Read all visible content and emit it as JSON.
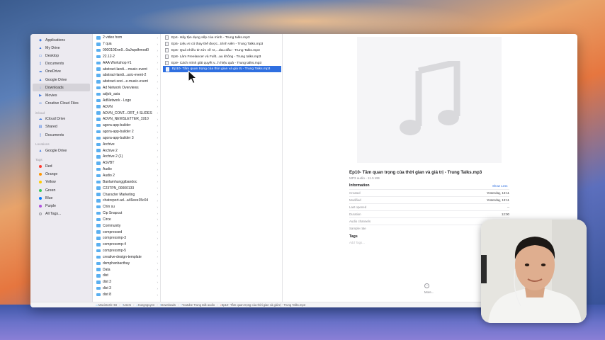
{
  "sidebar": {
    "favorites": [
      {
        "label": "Applications",
        "icon": "applications-icon"
      },
      {
        "label": "My Drive",
        "icon": "drive-icon"
      },
      {
        "label": "Desktop",
        "icon": "desktop-icon"
      },
      {
        "label": "Documents",
        "icon": "document-icon"
      },
      {
        "label": "OneDrive",
        "icon": "cloud-icon"
      },
      {
        "label": "Google Drive",
        "icon": "drive-icon"
      },
      {
        "label": "Downloads",
        "icon": "download-icon",
        "selected": true
      },
      {
        "label": "Movies",
        "icon": "movies-icon"
      },
      {
        "label": "Creative Cloud Files",
        "icon": "creative-cloud-icon"
      }
    ],
    "icloud_header": "iCloud",
    "icloud": [
      {
        "label": "iCloud Drive",
        "icon": "icloud-drive-icon"
      },
      {
        "label": "Shared",
        "icon": "shared-folder-icon"
      },
      {
        "label": "Documents",
        "icon": "document-icon"
      }
    ],
    "locations_header": "Locations",
    "locations": [
      {
        "label": "Google Drive",
        "icon": "drive-icon"
      }
    ],
    "tags_header": "Tags",
    "tags": [
      {
        "label": "Red",
        "color": "#ff3b30"
      },
      {
        "label": "Orange",
        "color": "#ff9500"
      },
      {
        "label": "Yellow",
        "color": "#ffcc00"
      },
      {
        "label": "Green",
        "color": "#34c759"
      },
      {
        "label": "Blue",
        "color": "#007aff"
      },
      {
        "label": "Purple",
        "color": "#af52de"
      },
      {
        "label": "All Tags...",
        "color": ""
      }
    ]
  },
  "folders": [
    "2 video hom",
    "7 qua",
    "000010Enn9...0aJwpdhmod0",
    "22.12-2",
    "AAA Workshop #1",
    "abstract-landi...-music-event",
    "abstract-landi...usic-event-2",
    "abstract-soci...e-music-event",
    "Ad Network Overviews",
    "adjob_asia",
    "AdNetwork - Logo",
    "ADVN",
    "ADVN_CONT...ORT_4 SLIDES",
    "ADVN_NEWSLETTER_1910",
    "agora-app-builder",
    "agora-app-builder 2",
    "agora-app-builder 3",
    "Archive",
    "Archive 2",
    "Archive 2 (1)",
    "ASVBT",
    "Audio",
    "Audio 2",
    "Banlamhunggibandoc",
    "C23TPN_00000133",
    "Character Marketing",
    "chatreport-ad...a46eee35c04",
    "Chin su",
    "Cip Snapcut",
    "Circe",
    "Community",
    "compressed",
    "compressmp-3",
    "compressmp-4",
    "compressmp-5",
    "creative-design-template",
    "dsmphanbacthay",
    "Data",
    "dist",
    "dist 3",
    "dist 3",
    "dist 8"
  ],
  "files": [
    {
      "name": "Ep4- Hãy tận dụng sếp của mình - Trung talks.mp3"
    },
    {
      "name": "Ep5- Liệu AI có thay thế được...trình viên - Trung Talks.mp3"
    },
    {
      "name": "Ep6- Quá nhiều tin tức về AI,...đau đầu - Trung Talks.mp3"
    },
    {
      "name": "Ep8- Làm Freelancer và Fullt...au không - Trung talks.mp3"
    },
    {
      "name": "Ep9- Cách mình giải quyết v...h hiệu quả - Trung talks.mp3"
    },
    {
      "name": "Ep10- Tầm quan trọng của thời gian và giá trị - Trung Talks.mp3",
      "selected": true
    }
  ],
  "preview": {
    "title": "Ep10- Tầm quan trọng của thời gian và giá trị - Trung Talks.mp3",
    "subtitle": "MP3 audio - 11.5 MB",
    "info_header": "Information",
    "show_less": "Show Less",
    "rows": [
      {
        "label": "Created",
        "value": "Yesterday, 13:11"
      },
      {
        "label": "Modified",
        "value": "Yesterday, 13:11"
      },
      {
        "label": "Last opened",
        "value": "--"
      },
      {
        "label": "Duration",
        "value": "12:00"
      },
      {
        "label": "Audio channels",
        "value": "--"
      },
      {
        "label": "Sample rate",
        "value": "--"
      }
    ],
    "tags_header": "Tags",
    "add_tags": "Add Tags...",
    "more_label": "More..."
  },
  "pathbar": [
    {
      "label": "Macintosh HD",
      "icon": "disk-icon"
    },
    {
      "label": "Users",
      "icon": "folder-icon"
    },
    {
      "label": "trungnguyen",
      "icon": "home-icon"
    },
    {
      "label": "Downloads",
      "icon": "folder-icon"
    },
    {
      "label": "Youtube Trung talk audio",
      "icon": "folder-icon"
    },
    {
      "label": "Ep10- Tầm quan trọng của thời gian và giá trị - Trung Talks.mp3",
      "icon": "audio-file-icon"
    }
  ],
  "colors": {
    "accent": "#2f6fe0",
    "folder": "#5aaff0",
    "sidebar_bg": "#eceaf0"
  }
}
